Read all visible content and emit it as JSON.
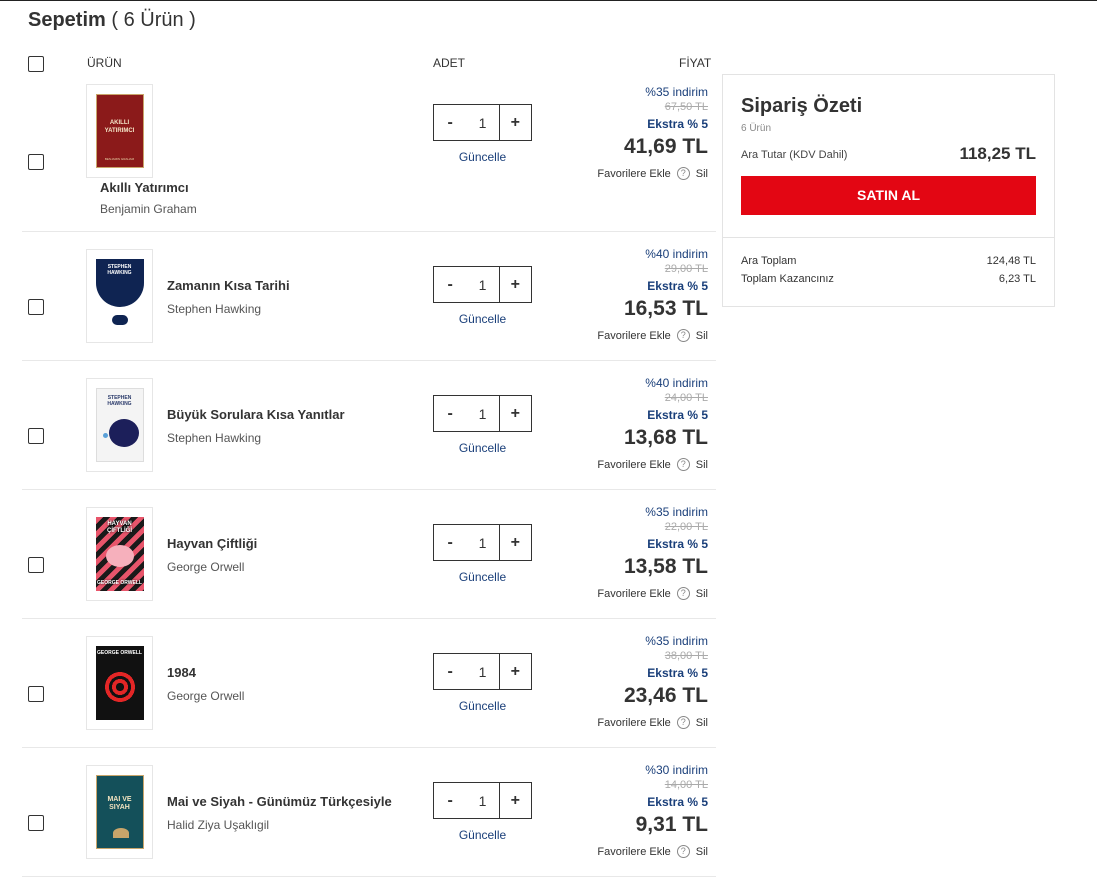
{
  "page": {
    "title": "Sepetim",
    "count": "( 6 Ürün )"
  },
  "headers": {
    "product": "ÜRÜN",
    "qty": "ADET",
    "price": "FİYAT"
  },
  "common": {
    "update": "Güncelle",
    "favorite": "Favorilere Ekle",
    "help": "?",
    "delete": "Sil",
    "minus": "-",
    "plus": "+"
  },
  "items": [
    {
      "title": "Akıllı Yatırımcı",
      "author": "Benjamin Graham",
      "qty": "1",
      "discount": "%35 indirim",
      "old_price": "67,50 TL",
      "extra": "Ekstra % 5",
      "price": "41,69 TL",
      "cover_title": "AKILLI YATIRIMCI",
      "cover_author": "BENJAMIN GRAHAM"
    },
    {
      "title": "Zamanın Kısa Tarihi",
      "author": "Stephen Hawking",
      "qty": "1",
      "discount": "%40 indirim",
      "old_price": "29,00 TL",
      "extra": "Ekstra % 5",
      "price": "16,53 TL",
      "cover_title": "STEPHEN HAWKING"
    },
    {
      "title": "Büyük Sorulara Kısa Yanıtlar",
      "author": "Stephen Hawking",
      "qty": "1",
      "discount": "%40 indirim",
      "old_price": "24,00 TL",
      "extra": "Ekstra % 5",
      "price": "13,68 TL",
      "cover_title": "STEPHEN HAWKING"
    },
    {
      "title": "Hayvan Çiftliği",
      "author": "George Orwell",
      "qty": "1",
      "discount": "%35 indirim",
      "old_price": "22,00 TL",
      "extra": "Ekstra % 5",
      "price": "13,58 TL",
      "cover_title": "HAYVAN ÇİFTLİĞİ",
      "cover_author": "GEORGE ORWELL"
    },
    {
      "title": "1984",
      "author": "George Orwell",
      "qty": "1",
      "discount": "%35 indirim",
      "old_price": "38,00 TL",
      "extra": "Ekstra % 5",
      "price": "23,46 TL",
      "cover_title": "GEORGE ORWELL"
    },
    {
      "title": "Mai ve Siyah - Günümüz Türkçesiyle",
      "author": "Halid Ziya Uşaklıgil",
      "qty": "1",
      "discount": "%30 indirim",
      "old_price": "14,00 TL",
      "extra": "Ekstra % 5",
      "price": "9,31 TL",
      "cover_title": "MAI VE SIYAH"
    }
  ],
  "summary": {
    "title": "Sipariş Özeti",
    "count": "6 Ürün",
    "subtotal_label": "Ara Tutar (KDV Dahil)",
    "subtotal_value": "118,25 TL",
    "buy_label": "SATIN AL",
    "gross_label": "Ara Toplam",
    "gross_value": "124,48 TL",
    "savings_label": "Toplam Kazancınız",
    "savings_value": "6,23 TL"
  },
  "colors": {
    "accent_red": "#e30613",
    "link_blue": "#1a3f7a"
  }
}
